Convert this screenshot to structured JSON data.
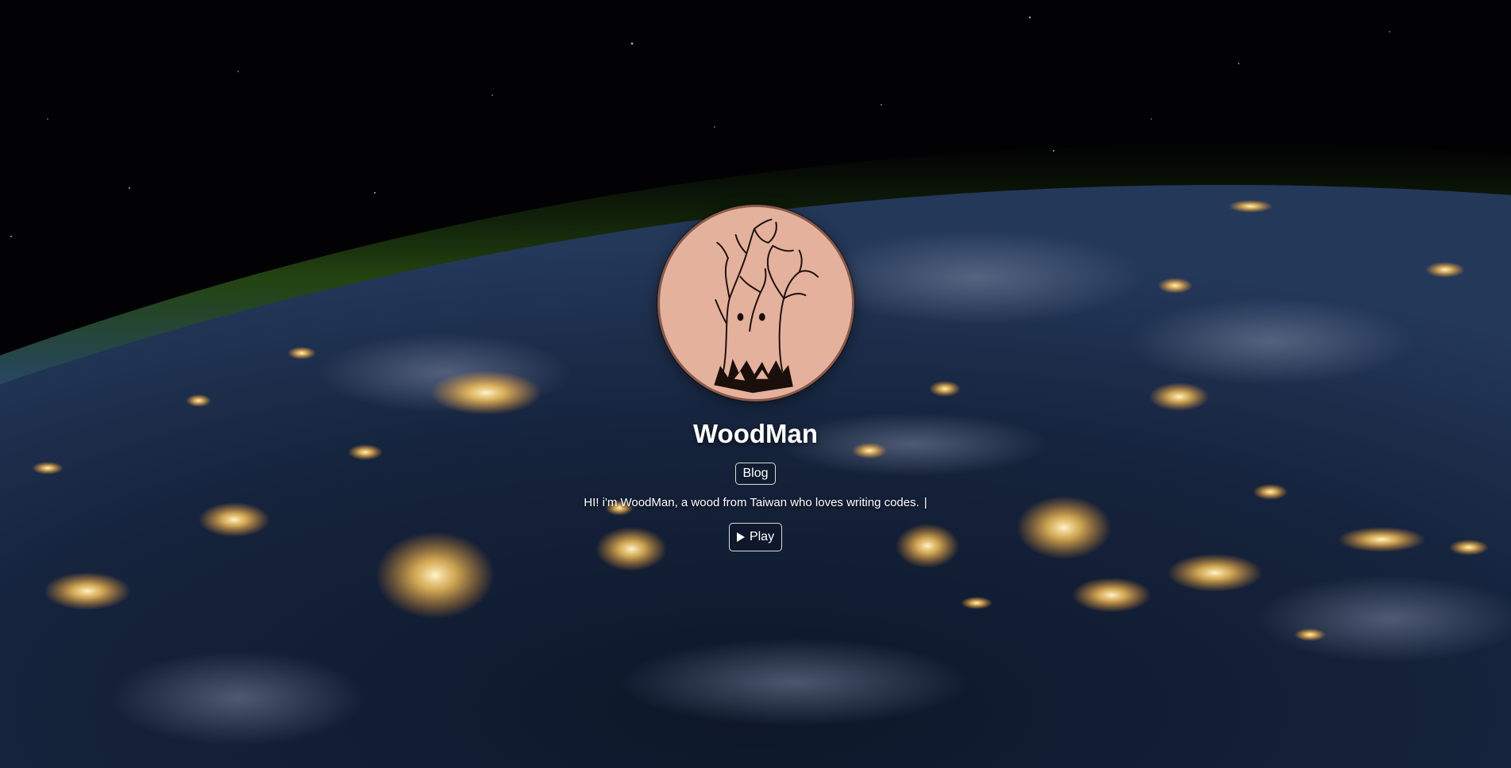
{
  "profile": {
    "name": "WoodMan",
    "avatar_icon": "tree-face-icon",
    "intro": "HI! i'm WoodMan, a wood from Taiwan who loves writing codes.",
    "cursor": "|"
  },
  "nav": {
    "blog_label": "Blog"
  },
  "player": {
    "play_label": "Play",
    "play_icon": "play-icon"
  },
  "colors": {
    "avatar_bg": "#e3b19c",
    "text": "#ffffff"
  }
}
